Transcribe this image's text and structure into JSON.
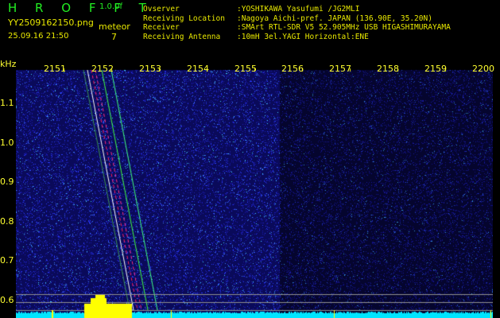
{
  "header": {
    "app_title": "H R O F F T",
    "version": "1.0.0f",
    "filename": "YY2509162150.png",
    "datetime": "25.09.16 21:50",
    "meteor_label": "meteor",
    "meteor_count": "7"
  },
  "info": [
    {
      "label": "Ovserver",
      "value": ":YOSHIKAWA Yasufumi /JG2MLI"
    },
    {
      "label": "Receiving Location",
      "value": ":Nagoya Aichi-pref. JAPAN (136.90E, 35.20N)"
    },
    {
      "label": "Receiver",
      "value": ":SMArt RTL-SDR V5 52.905MHz USB HIGASHIMURAYAMA"
    },
    {
      "label": "Receiving Antenna",
      "value": ":10mH 3el.YAGI Horizontal:ENE"
    }
  ],
  "axis": {
    "y_unit": "kHz",
    "y_ticks": [
      "1.1",
      "1.0",
      "0.9",
      "0.8",
      "0.7",
      "0.6"
    ],
    "x_ticks": [
      "2151",
      "2152",
      "2153",
      "2154",
      "2155",
      "2156",
      "2157",
      "2158",
      "2159",
      "2200"
    ]
  },
  "colors": {
    "text_yellow": "#e8e800",
    "title_green": "#22ee22",
    "baseline_cyan": "#00e5ff",
    "signal_yellow": "#ffff00"
  }
}
